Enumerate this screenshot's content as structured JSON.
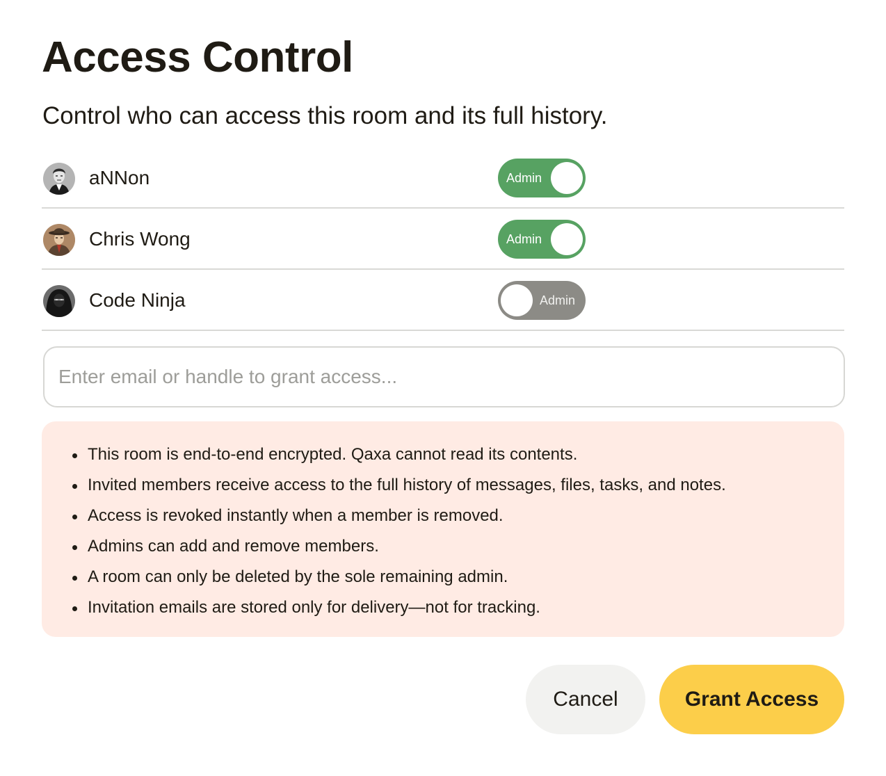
{
  "dialog": {
    "title": "Access Control",
    "subtitle": "Control who can access this room and its full history."
  },
  "members": [
    {
      "name": "aNNon",
      "toggle_label": "Admin",
      "is_admin": true,
      "avatar": "avatar-noir-man-icon"
    },
    {
      "name": "Chris Wong",
      "toggle_label": "Admin",
      "is_admin": true,
      "avatar": "avatar-detective-fedora-icon"
    },
    {
      "name": "Code Ninja",
      "toggle_label": "Admin",
      "is_admin": false,
      "avatar": "avatar-hooded-ninja-icon"
    }
  ],
  "invite": {
    "placeholder": "Enter email or handle to grant access...",
    "value": ""
  },
  "info": {
    "items": [
      "This room is end-to-end encrypted. Qaxa cannot read its contents.",
      "Invited members receive access to the full history of messages, files, tasks, and notes.",
      "Access is revoked instantly when a member is removed.",
      "Admins can add and remove members.",
      "A room can only be deleted by the sole remaining admin.",
      "Invitation emails are stored only for delivery—not for tracking."
    ]
  },
  "actions": {
    "cancel_label": "Cancel",
    "grant_label": "Grant Access"
  },
  "colors": {
    "toggle_on": "#57a262",
    "toggle_off": "#8c8b86",
    "info_background": "#ffebe4",
    "primary_button": "#fcce4a",
    "secondary_button": "#f2f2f0"
  }
}
